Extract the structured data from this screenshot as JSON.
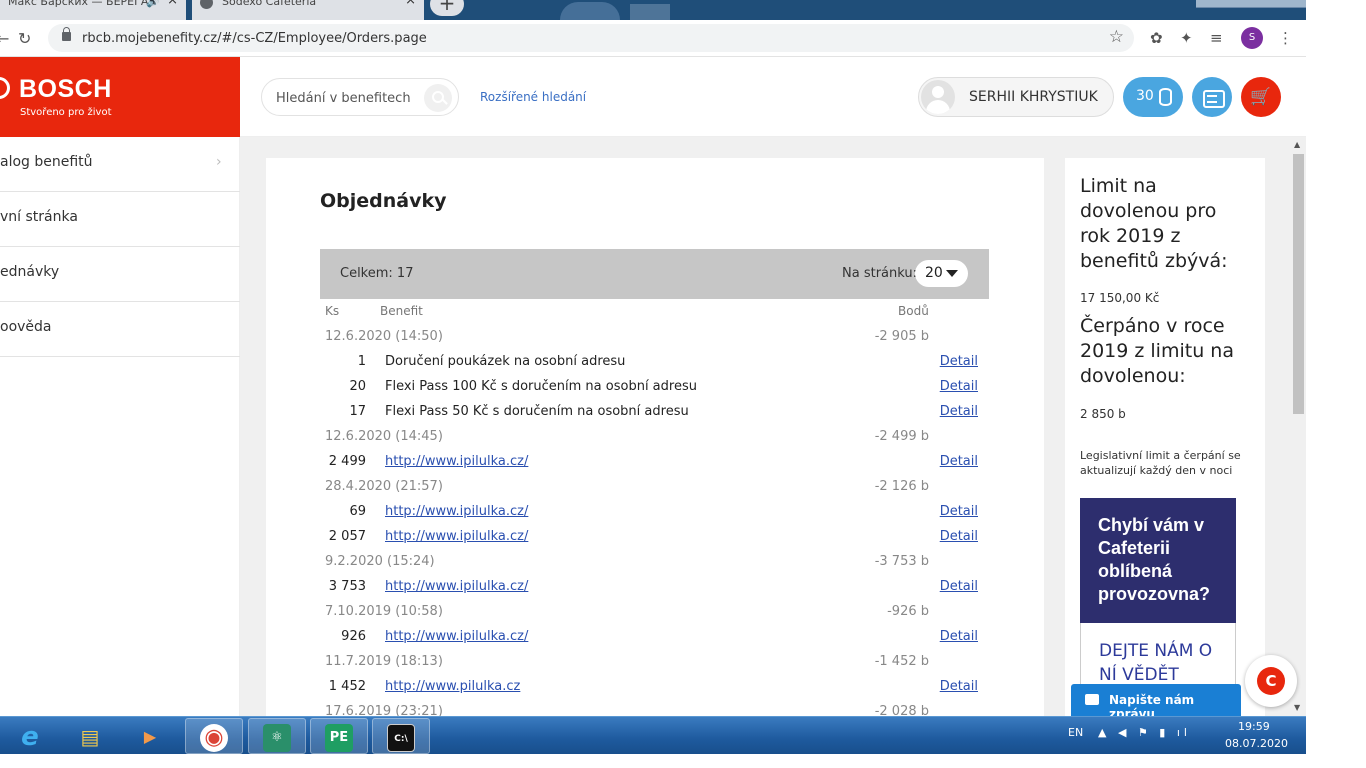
{
  "browser": {
    "tabs": [
      {
        "title": "Макс Барских — БЕРЕГА",
        "audio_icon": "🔊"
      },
      {
        "title": "Sodexo Cafeteria"
      }
    ],
    "new_tab": "+",
    "url": "rbcb.mojebenefity.cz/#/cs-CZ/Employee/Orders.page",
    "profile_initial": "S"
  },
  "brand": {
    "name": "BOSCH",
    "tagline": "Stvořeno pro život",
    "color": "#e8270d"
  },
  "sidebar": {
    "items": [
      {
        "label": "alog benefitů",
        "chevron": "›"
      },
      {
        "label": "vní stránka"
      },
      {
        "label": "ednávky"
      },
      {
        "label": "oověda"
      }
    ]
  },
  "header": {
    "search_placeholder": "Hledání v benefitech",
    "advanced_search": "Rozšířené hledání",
    "user_name": "SERHII KHRYSTIUK",
    "points": "30",
    "accent": "#4aa6e0"
  },
  "orders": {
    "title": "Objednávky",
    "total_label": "Celkem: 17",
    "per_page_label": "Na stránku:",
    "per_page_value": "20",
    "columns": {
      "qty": "Ks",
      "benefit": "Benefit",
      "points": "Bodů"
    },
    "rows": [
      {
        "type": "date",
        "date": "12.6.2020 (14:50)",
        "points": "-2 905 b"
      },
      {
        "type": "item",
        "qty": "1",
        "benefit": "Doručení poukázek na osobní adresu",
        "link": false,
        "detail": "Detail"
      },
      {
        "type": "item",
        "qty": "20",
        "benefit": "Flexi Pass 100 Kč s doručením na osobní adresu",
        "link": false,
        "detail": "Detail"
      },
      {
        "type": "item",
        "qty": "17",
        "benefit": "Flexi Pass 50 Kč s doručením na osobní adresu",
        "link": false,
        "detail": "Detail"
      },
      {
        "type": "date",
        "date": "12.6.2020 (14:45)",
        "points": "-2 499 b"
      },
      {
        "type": "item",
        "qty": "2 499",
        "benefit": "http://www.ipilulka.cz/",
        "link": true,
        "detail": "Detail"
      },
      {
        "type": "date",
        "date": "28.4.2020 (21:57)",
        "points": "-2 126 b"
      },
      {
        "type": "item",
        "qty": "69",
        "benefit": "http://www.ipilulka.cz/",
        "link": true,
        "detail": "Detail"
      },
      {
        "type": "item",
        "qty": "2 057",
        "benefit": "http://www.ipilulka.cz/",
        "link": true,
        "detail": "Detail"
      },
      {
        "type": "date",
        "date": "9.2.2020 (15:24)",
        "points": "-3 753 b"
      },
      {
        "type": "item",
        "qty": "3 753",
        "benefit": "http://www.ipilulka.cz/",
        "link": true,
        "detail": "Detail"
      },
      {
        "type": "date",
        "date": "7.10.2019 (10:58)",
        "points": "-926 b"
      },
      {
        "type": "item",
        "qty": "926",
        "benefit": "http://www.ipilulka.cz/",
        "link": true,
        "detail": "Detail"
      },
      {
        "type": "date",
        "date": "11.7.2019 (18:13)",
        "points": "-1 452 b"
      },
      {
        "type": "item",
        "qty": "1 452",
        "benefit": "http://www.pilulka.cz",
        "link": true,
        "detail": "Detail"
      },
      {
        "type": "date",
        "date": "17.6.2019 (23:21)",
        "points": "-2 028 b"
      }
    ]
  },
  "right_panel": {
    "limit_title": "Limit na dovolenou pro rok 2019 z benefitů zbývá:",
    "limit_value": "17 150,00 Kč",
    "used_title": "Čerpáno v roce 2019 z limitu na dovolenou:",
    "used_value": "2 850 b",
    "note": "Legislativní limit a čerpání se aktualizují každý den v noci",
    "promo_title": "Chybí vám v Cafeterii oblíbená provozovna?",
    "promo_cta": "DEJTE NÁM O NÍ VĚDĚT",
    "promo_color": "#2d2e6e"
  },
  "chat": {
    "button_label": "Napište nám zprávu",
    "widget_letter": "C"
  },
  "taskbar": {
    "apps": [
      {
        "name": "ie",
        "glyph": "e"
      },
      {
        "name": "explorer",
        "glyph": "▤"
      },
      {
        "name": "media",
        "glyph": "▶"
      },
      {
        "name": "chrome",
        "glyph": "◉"
      },
      {
        "name": "atom",
        "glyph": "⚛"
      },
      {
        "name": "pycharm",
        "glyph": "PE"
      },
      {
        "name": "terminal",
        "glyph": "C:\\"
      }
    ],
    "lang": "EN",
    "time": "19:59",
    "date": "08.07.2020"
  }
}
